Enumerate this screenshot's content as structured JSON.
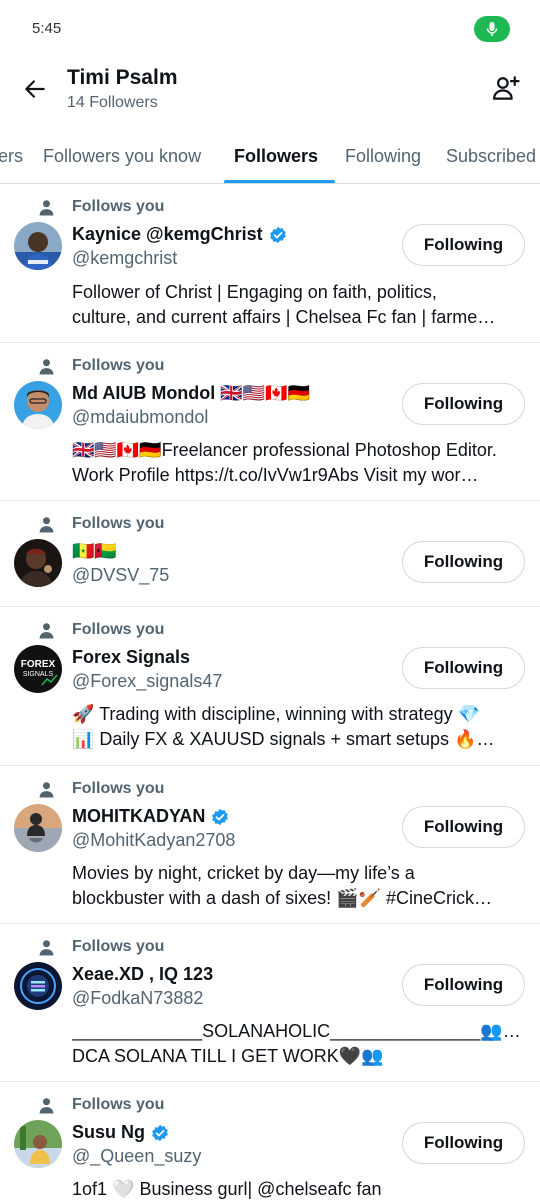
{
  "status": {
    "time": "5:45"
  },
  "header": {
    "title": "Timi Psalm",
    "subtitle": "14 Followers"
  },
  "tabs": [
    {
      "label": "ers"
    },
    {
      "label": "Followers you know"
    },
    {
      "label": "Followers"
    },
    {
      "label": "Following"
    },
    {
      "label": "Subscribed"
    }
  ],
  "colors": {
    "accent": "#1d9bf0",
    "verified": "#1d9bf0",
    "muted": "#536471",
    "mic": "#1fb954"
  },
  "rows": [
    {
      "follows_you": "Follows you",
      "name": "Kaynice @kemgChrist",
      "verified": true,
      "handle": "@kemgchrist",
      "button": "Following",
      "bio": [
        "Follower of Christ | Engaging on faith, politics,",
        "culture, and current affairs | Chelsea Fc fan | farme…"
      ]
    },
    {
      "follows_you": "Follows you",
      "name": "Md AIUB Mondol 🇬🇧🇺🇸🇨🇦🇩🇪",
      "verified": false,
      "handle": "@mdaiubmondol",
      "button": "Following",
      "bio": [
        "🇬🇧🇺🇸🇨🇦🇩🇪Freelancer professional Photoshop Editor.",
        "Work  Profile https://t.co/IvVw1r9Abs  Visit my wor…"
      ]
    },
    {
      "follows_you": "Follows you",
      "name": "🇸🇳🇬🇼",
      "verified": false,
      "handle": "@DVSV_75",
      "button": "Following",
      "bio": []
    },
    {
      "follows_you": "Follows you",
      "name": "Forex Signals",
      "verified": false,
      "handle": "@Forex_signals47",
      "button": "Following",
      "bio": [
        "🚀 Trading with discipline, winning with strategy 💎",
        "📊 Daily FX & XAUUSD signals + smart setups 🔥…"
      ]
    },
    {
      "follows_you": "Follows you",
      "name": "MOHITKADYAN",
      "verified": true,
      "handle": "@MohitKadyan2708",
      "button": "Following",
      "bio": [
        "Movies by night, cricket by day—my life’s a",
        "blockbuster with a dash of sixes! 🎬🏏 #CineCrick…"
      ]
    },
    {
      "follows_you": "Follows you",
      "name": "Xeae.XD , IQ 123",
      "verified": false,
      "handle": "@FodkaN73882",
      "button": "Following",
      "bio": [
        "_____________SOLANAHOLIC_______________👥🖤",
        "DCA SOLANA TILL I GET WORK🖤👥"
      ]
    },
    {
      "follows_you": "Follows you",
      "name": "Susu Ng",
      "verified": true,
      "handle": "@_Queen_suzy",
      "button": "Following",
      "bio": [
        "1of1 🤍 Business gurl| @chelseafc fan"
      ]
    }
  ]
}
